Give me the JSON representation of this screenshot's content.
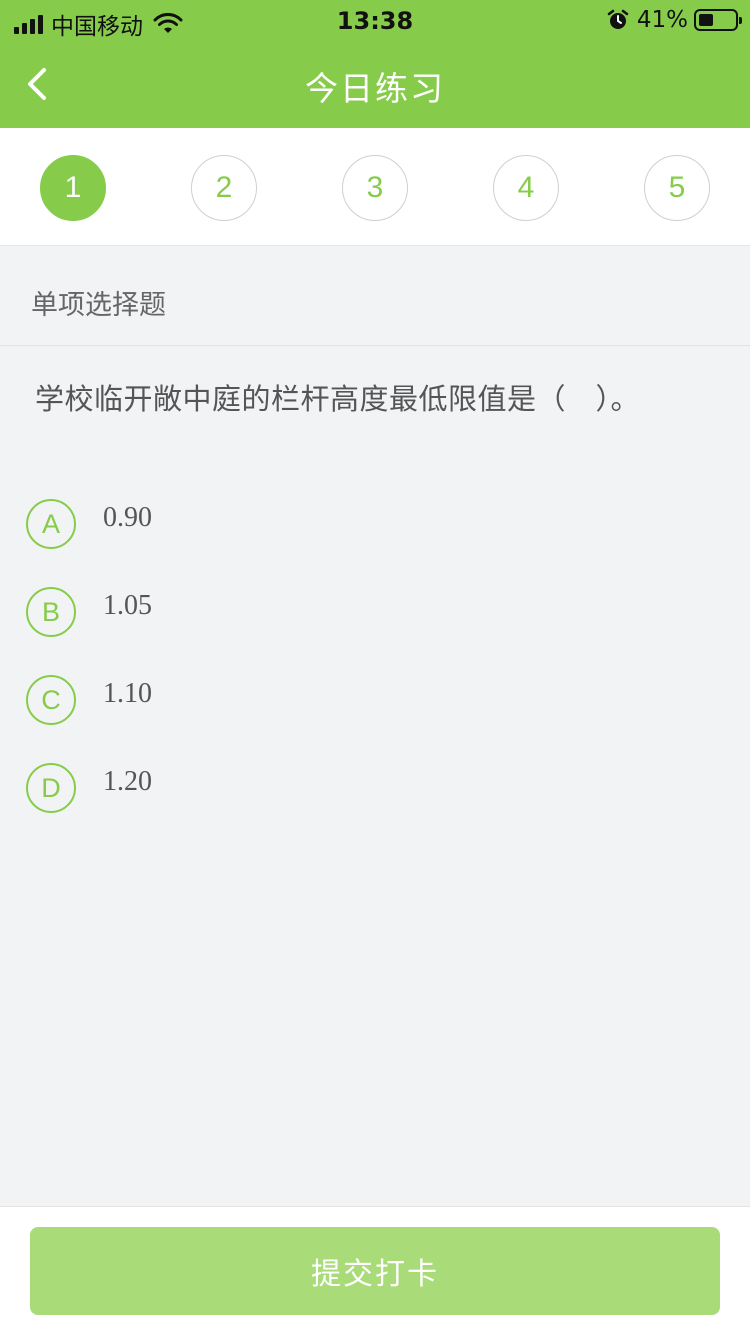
{
  "status_bar": {
    "carrier": "中国移动",
    "time": "13:38",
    "battery_percent": "41%",
    "battery_level": 0.41,
    "icons": [
      "signal-icon",
      "wifi-icon",
      "alarm-icon",
      "battery-icon"
    ]
  },
  "nav": {
    "title": "今日练习",
    "back_icon": "chevron-left-icon"
  },
  "steps": {
    "items": [
      "1",
      "2",
      "3",
      "4",
      "5"
    ],
    "active": "1"
  },
  "question": {
    "type": "单项选择题",
    "text": "学校临开敞中庭的栏杆高度最低限值是（　）。",
    "options": [
      {
        "letter": "A",
        "text": "0.90"
      },
      {
        "letter": "B",
        "text": "1.05"
      },
      {
        "letter": "C",
        "text": "1.10"
      },
      {
        "letter": "D",
        "text": "1.20"
      }
    ]
  },
  "footer": {
    "submit_label": "提交打卡"
  },
  "colors": {
    "accent": "#86cc4a",
    "button_disabled": "#a9dc78",
    "background": "#f2f3f5"
  }
}
